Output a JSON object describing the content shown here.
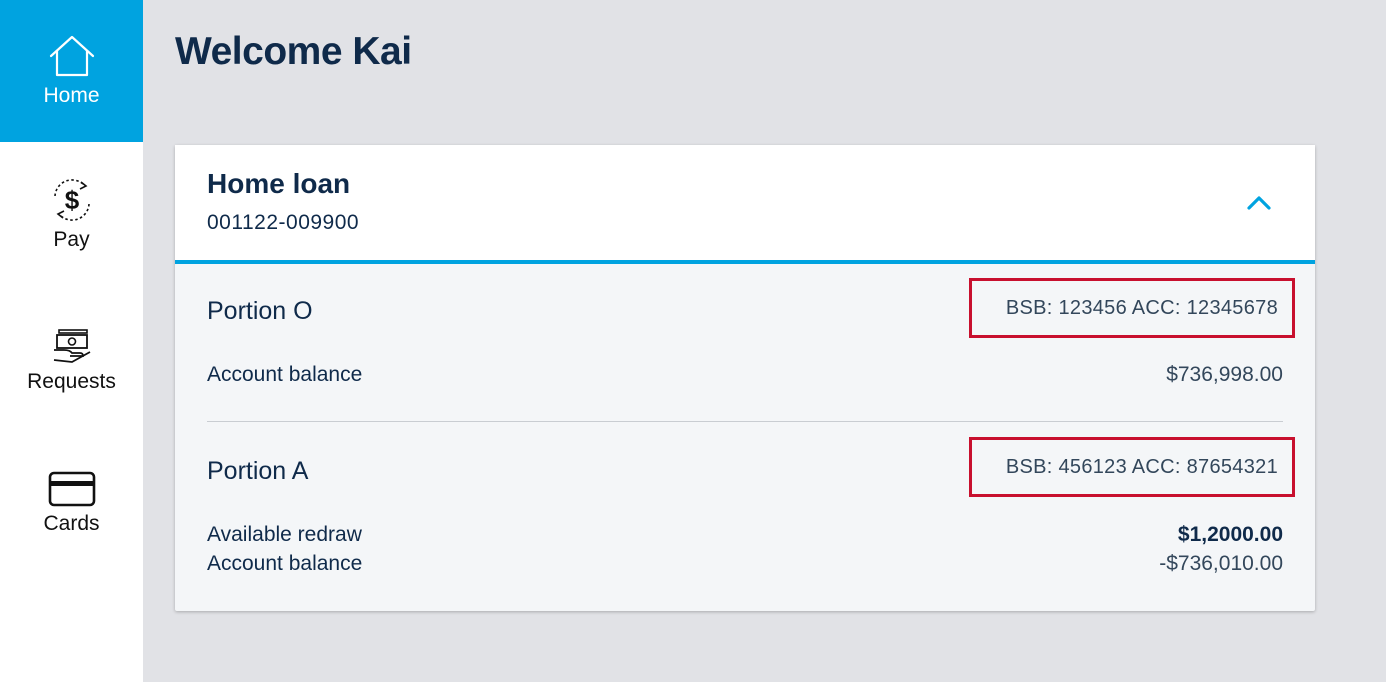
{
  "nav": {
    "home": {
      "label": "Home",
      "icon": "home-icon"
    },
    "pay": {
      "label": "Pay",
      "icon": "dollar-cycle-icon"
    },
    "requests": {
      "label": "Requests",
      "icon": "cash-hand-icon"
    },
    "cards": {
      "label": "Cards",
      "icon": "credit-card-icon"
    }
  },
  "page": {
    "title": "Welcome Kai"
  },
  "loan": {
    "title": "Home loan",
    "number": "001122-009900",
    "expanded": true,
    "portions": [
      {
        "name": "Portion O",
        "account": "BSB: 123456 ACC: 12345678",
        "rows": [
          {
            "label": "Account balance",
            "value": "$736,998.00"
          }
        ]
      },
      {
        "name": "Portion A",
        "account": "BSB: 456123 ACC: 87654321",
        "rows": [
          {
            "label": "Available redraw",
            "value": "$1,2000.00"
          },
          {
            "label": "Account balance",
            "value": "-$736,010.00"
          }
        ]
      }
    ]
  },
  "colors": {
    "accent": "#00a3e0",
    "navy": "#0f2a4a",
    "highlight_border": "#c8102e",
    "background": "#e1e2e6"
  }
}
